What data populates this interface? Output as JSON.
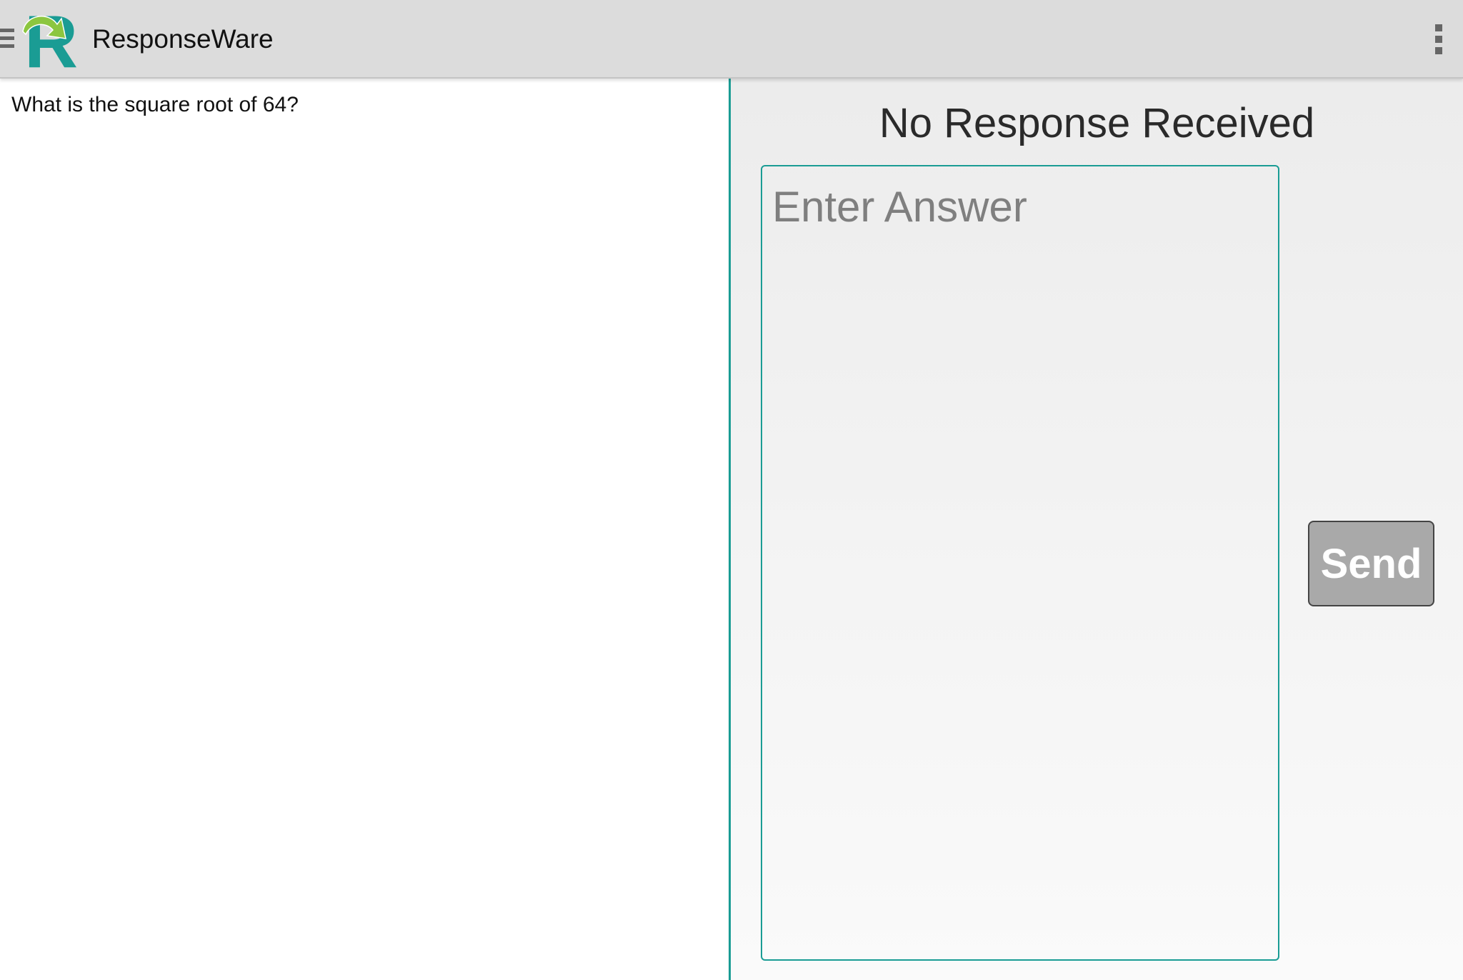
{
  "app": {
    "title": "ResponseWare",
    "logo_letter": "R",
    "logo_icon": "responseware-logo",
    "menu_icon": "hamburger-icon",
    "overflow_icon": "more-vert-icon"
  },
  "question": {
    "text": "What is the square root of 64?"
  },
  "response": {
    "status": "No Response Received",
    "answer_value": "",
    "answer_placeholder": "Enter Answer",
    "send_label": "Send"
  },
  "colors": {
    "accent": "#1a9c94",
    "logo_green": "#8cc63f",
    "appbar": "#dcdcdc",
    "send_button": "#a9a9a9"
  }
}
